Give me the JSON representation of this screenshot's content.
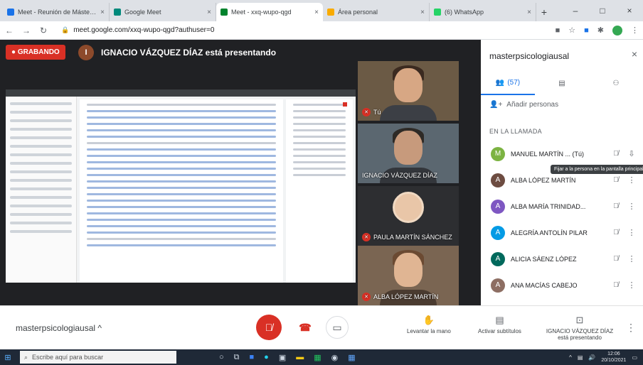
{
  "browser": {
    "tabs": [
      {
        "title": "Meet - Reunión de Máster en Psicología",
        "favicon_color": "#1a73e8",
        "active": false
      },
      {
        "title": "Google Meet",
        "favicon_color": "#00897b",
        "active": false
      },
      {
        "title": "Meet - xxq-wupo-qgd",
        "favicon_color": "#00832d",
        "active": true
      },
      {
        "title": "Área personal",
        "favicon_color": "#f9ab00",
        "active": false
      },
      {
        "title": "(6) WhatsApp",
        "favicon_color": "#25d366",
        "active": false
      }
    ],
    "url": "meet.google.com/xxq-wupo-qgd?authuser=0",
    "new_tab": "+",
    "win_min": "–",
    "win_max": "□",
    "win_close": "×"
  },
  "meet": {
    "recording_label": "● GRABANDO",
    "presenter_initial": "I",
    "presenting_text": "IGNACIO VÁZQUEZ DÍAZ está presentando",
    "tiles": [
      {
        "name": "Tú"
      },
      {
        "name": "IGNACIO VÁZQUEZ DÍAZ"
      },
      {
        "name": "PAULA MARTÍN SÁNCHEZ"
      },
      {
        "name": "ALBA LÓPEZ MARTÍN"
      }
    ]
  },
  "panel": {
    "title": "masterpsicologiausal",
    "close": "×",
    "tabs": [
      {
        "label": "(57)",
        "icon": "people-icon"
      },
      {
        "label": "",
        "icon": "chat-icon"
      },
      {
        "label": "",
        "icon": "activities-icon"
      }
    ],
    "add_people": "Añadir personas",
    "section_label": "EN LA LLAMADA",
    "tooltip": "Fijar a la persona en la pantalla principal",
    "participants": [
      {
        "name": "MANUEL MARTÍN ... (Tú)",
        "initial": "M",
        "color": "#7cb342"
      },
      {
        "name": "ALBA LÓPEZ MARTÍN",
        "initial": "A",
        "color": "#6d4c41"
      },
      {
        "name": "ALBA MARÍA TRINIDAD...",
        "initial": "A",
        "color": "#7e57c2"
      },
      {
        "name": "ALEGRÍA ANTOLÍN PILAR",
        "initial": "A",
        "color": "#039be5"
      },
      {
        "name": "ALICIA SÁENZ LÓPEZ",
        "initial": "A",
        "color": "#00695c"
      },
      {
        "name": "ANA MACÍAS CABEJO",
        "initial": "A",
        "color": "#8d6e63"
      }
    ]
  },
  "bottom": {
    "meeting_name": "masterpsicologiausal ^",
    "raise_hand": "Levantar la mano",
    "captions": "Activar subtítulos",
    "presenting": "IGNACIO VÁZQUEZ DÍAZ está presentando",
    "more": "⋮"
  },
  "taskbar": {
    "search_placeholder": "Escribe aquí para buscar",
    "time": "12:06",
    "date": "20/10/2021"
  }
}
